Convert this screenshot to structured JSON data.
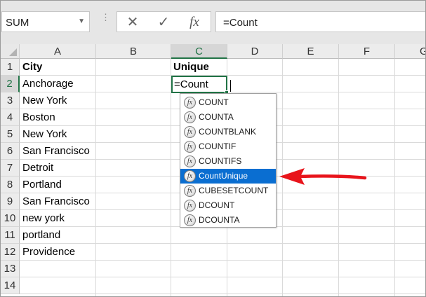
{
  "formula_bar": {
    "name_box": "SUM",
    "name_box_arrow": "▼",
    "separator": "⋮",
    "cancel_icon": "✕",
    "enter_icon": "✓",
    "fx_label": "fx",
    "formula": "=Count"
  },
  "columns": [
    "A",
    "B",
    "C",
    "D",
    "E",
    "F",
    "G"
  ],
  "rows": [
    "1",
    "2",
    "3",
    "4",
    "5",
    "6",
    "7",
    "8",
    "9",
    "10",
    "11",
    "12",
    "13",
    "14"
  ],
  "active_column": "C",
  "active_row": "2",
  "cells": {
    "A1": "City",
    "C1": "Unique",
    "A2": "Anchorage",
    "A3": "New York",
    "A4": "Boston",
    "A5": "New York",
    "A6": "San Francisco",
    "A7": "Detroit",
    "A8": "Portland",
    "A9": "San Francisco",
    "A10": "new york",
    "A11": "portland",
    "A12": "Providence"
  },
  "active_cell_value": "=Count",
  "autocomplete": {
    "icon_label": "fx",
    "items": [
      "COUNT",
      "COUNTA",
      "COUNTBLANK",
      "COUNTIF",
      "COUNTIFS",
      "CountUnique",
      "CUBESETCOUNT",
      "DCOUNT",
      "DCOUNTA"
    ],
    "selected_index": 5
  },
  "colors": {
    "accent": "#217346",
    "selection": "#0a6ed1",
    "arrow": "#e8141b"
  }
}
